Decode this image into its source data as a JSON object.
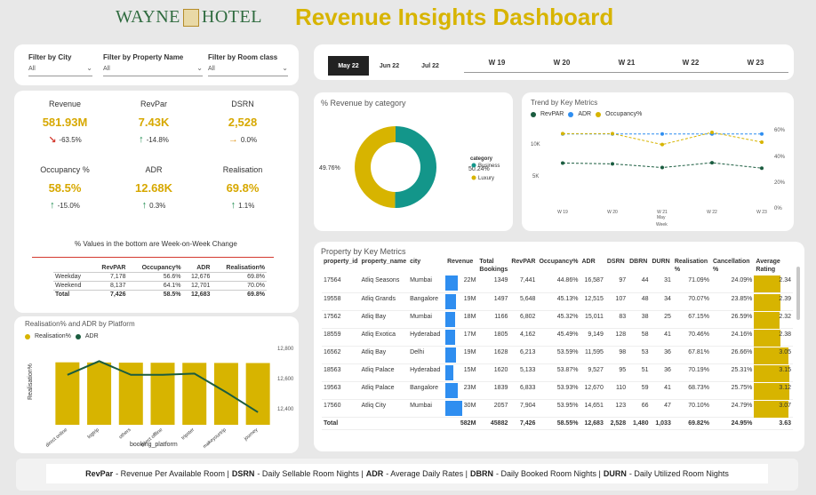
{
  "header": {
    "logo_left": "WAYNE",
    "logo_right": "HOTEL",
    "title": "Revenue Insights Dashboard"
  },
  "filters": [
    {
      "label": "Filter by City",
      "value": "All"
    },
    {
      "label": "Filter by Property Name",
      "value": "All"
    },
    {
      "label": "Filter by Room class",
      "value": "All"
    }
  ],
  "months": [
    "May 22",
    "Jun 22",
    "Jul 22"
  ],
  "weeks": [
    "W 19",
    "W 20",
    "W 21",
    "W 22",
    "W 23"
  ],
  "kpis": [
    {
      "name": "Revenue",
      "value": "581.93M",
      "change": "-63.5%",
      "trend": "down"
    },
    {
      "name": "RevPar",
      "value": "7.43K",
      "change": "-14.8%",
      "trend": "up"
    },
    {
      "name": "DSRN",
      "value": "2,528",
      "change": "0.0%",
      "trend": "flat"
    },
    {
      "name": "Occupancy %",
      "value": "58.5%",
      "change": "-15.0%",
      "trend": "up"
    },
    {
      "name": "ADR",
      "value": "12.68K",
      "change": "0.3%",
      "trend": "up"
    },
    {
      "name": "Realisation",
      "value": "69.8%",
      "change": "1.1%",
      "trend": "up"
    }
  ],
  "kpi_note": "% Values in the bottom are Week-on-Week Change",
  "weekday_table": {
    "headers": [
      "",
      "RevPAR",
      "Occupancy%",
      "ADR",
      "Realisation%"
    ],
    "rows": [
      [
        "Weekday",
        "7,178",
        "56.6%",
        "12,676",
        "69.8%"
      ],
      [
        "Weekend",
        "8,137",
        "64.1%",
        "12,701",
        "70.0%"
      ],
      [
        "Total",
        "7,426",
        "58.5%",
        "12,683",
        "69.8%"
      ]
    ]
  },
  "platform_chart": {
    "title": "Realisation% and ADR by Platform",
    "legend": [
      "Realisation%",
      "ADR"
    ],
    "xlabel": "booking_platform",
    "ylabel": "Realisation%",
    "y2_ticks": [
      "12,800",
      "12,600",
      "12,400"
    ],
    "colors": {
      "bar": "#d7b400",
      "line": "#1a5c3f"
    }
  },
  "category_chart": {
    "title": "% Revenue by category",
    "legend_title": "category",
    "colors": {
      "Business": "#13968a",
      "Luxury": "#d7b400"
    }
  },
  "trend_chart": {
    "title": "Trend by Key Metrics",
    "legend": [
      "RevPAR",
      "ADR",
      "Occupancy%"
    ],
    "y_left_ticks": [
      "10K",
      "5K"
    ],
    "y_right_ticks": [
      "60%",
      "40%",
      "20%",
      "0%"
    ],
    "xlabel": "Week",
    "x_sub": "May",
    "colors": {
      "RevPAR": "#1a5c3f",
      "ADR": "#2f8ef0",
      "Occupancy%": "#d7b400"
    }
  },
  "property_table": {
    "title": "Property by Key Metrics",
    "headers": [
      "property_id",
      "property_name",
      "city",
      "Revenue",
      "Total Bookings",
      "RevPAR",
      "Occupancy%",
      "ADR",
      "DSRN",
      "DBRN",
      "DURN",
      "Realisation %",
      "Cancellation %",
      "Average Rating"
    ],
    "rows": [
      {
        "id": "17564",
        "name": "Atliq Seasons",
        "city": "Mumbai",
        "revenue": "22M",
        "rev_val": 22,
        "bookings": "1349",
        "revpar": "7,441",
        "occ": "44.86%",
        "adr": "16,587",
        "dsrn": "97",
        "dbrn": "44",
        "durn": "31",
        "real": "71.09%",
        "cancel": "24.09%",
        "rating": "2.34",
        "rating_val": 2.34
      },
      {
        "id": "19558",
        "name": "Atliq Grands",
        "city": "Bangalore",
        "revenue": "19M",
        "rev_val": 19,
        "bookings": "1497",
        "revpar": "5,648",
        "occ": "45.13%",
        "adr": "12,515",
        "dsrn": "107",
        "dbrn": "48",
        "durn": "34",
        "real": "70.07%",
        "cancel": "23.85%",
        "rating": "2.39",
        "rating_val": 2.39
      },
      {
        "id": "17562",
        "name": "Atliq Bay",
        "city": "Mumbai",
        "revenue": "18M",
        "rev_val": 18,
        "bookings": "1166",
        "revpar": "6,802",
        "occ": "45.32%",
        "adr": "15,011",
        "dsrn": "83",
        "dbrn": "38",
        "durn": "25",
        "real": "67.15%",
        "cancel": "26.59%",
        "rating": "2.32",
        "rating_val": 2.32
      },
      {
        "id": "18559",
        "name": "Atliq Exotica",
        "city": "Hyderabad",
        "revenue": "17M",
        "rev_val": 17,
        "bookings": "1805",
        "revpar": "4,162",
        "occ": "45.49%",
        "adr": "9,149",
        "dsrn": "128",
        "dbrn": "58",
        "durn": "41",
        "real": "70.46%",
        "cancel": "24.16%",
        "rating": "2.38",
        "rating_val": 2.38
      },
      {
        "id": "16562",
        "name": "Atliq Bay",
        "city": "Delhi",
        "revenue": "19M",
        "rev_val": 19,
        "bookings": "1628",
        "revpar": "6,213",
        "occ": "53.59%",
        "adr": "11,595",
        "dsrn": "98",
        "dbrn": "53",
        "durn": "36",
        "real": "67.81%",
        "cancel": "26.66%",
        "rating": "3.05",
        "rating_val": 3.05
      },
      {
        "id": "18563",
        "name": "Atliq Palace",
        "city": "Hyderabad",
        "revenue": "15M",
        "rev_val": 15,
        "bookings": "1620",
        "revpar": "5,133",
        "occ": "53.87%",
        "adr": "9,527",
        "dsrn": "95",
        "dbrn": "51",
        "durn": "36",
        "real": "70.19%",
        "cancel": "25.31%",
        "rating": "3.15",
        "rating_val": 3.15
      },
      {
        "id": "19563",
        "name": "Atliq Palace",
        "city": "Bangalore",
        "revenue": "23M",
        "rev_val": 23,
        "bookings": "1839",
        "revpar": "6,833",
        "occ": "53.93%",
        "adr": "12,670",
        "dsrn": "110",
        "dbrn": "59",
        "durn": "41",
        "real": "68.73%",
        "cancel": "25.75%",
        "rating": "3.12",
        "rating_val": 3.12
      },
      {
        "id": "17560",
        "name": "Atliq City",
        "city": "Mumbai",
        "revenue": "30M",
        "rev_val": 30,
        "bookings": "2057",
        "revpar": "7,904",
        "occ": "53.95%",
        "adr": "14,651",
        "dsrn": "123",
        "dbrn": "66",
        "durn": "47",
        "real": "70.10%",
        "cancel": "24.79%",
        "rating": "3.07",
        "rating_val": 3.07
      }
    ],
    "total": {
      "label": "Total",
      "revenue": "582M",
      "bookings": "45882",
      "revpar": "7,426",
      "occ": "58.55%",
      "adr": "12,683",
      "dsrn": "2,528",
      "dbrn": "1,480",
      "durn": "1,033",
      "real": "69.82%",
      "cancel": "24.95%",
      "rating": "3.63"
    }
  },
  "footer": {
    "k1": "RevPar",
    "d1": "- Revenue Per Available Room |",
    "k2": "DSRN",
    "d2": "- Daily Sellable Room Nights |",
    "k3": "ADR",
    "d3": "- Average Daily Rates |",
    "k4": "DBRN",
    "d4": "- Daily Booked Room Nights |",
    "k5": "DURN",
    "d5": "- Daily Utilized Room Nights"
  },
  "chart_data": [
    {
      "type": "bar",
      "title": "Realisation% and ADR by Platform",
      "categories": [
        "direct online",
        "logtrip",
        "others",
        "direct offline",
        "tripster",
        "makeyourtrip",
        "journey"
      ],
      "series": [
        {
          "name": "Realisation%",
          "values": [
            70.3,
            70.1,
            69.9,
            69.8,
            69.7,
            69.6,
            69.5
          ]
        },
        {
          "name": "ADR",
          "values": [
            12680,
            12790,
            12680,
            12680,
            12690,
            12540,
            12380
          ]
        }
      ],
      "xlabel": "booking_platform",
      "ylabel": "Realisation%",
      "ylim": [
        0,
        80
      ],
      "y2lim": [
        12350,
        12850
      ]
    },
    {
      "type": "pie",
      "title": "% Revenue by category",
      "categories": [
        "Business",
        "Luxury"
      ],
      "values": [
        50.24,
        49.76
      ]
    },
    {
      "type": "line",
      "title": "Trend by Key Metrics",
      "x": [
        "W 19",
        "W 20",
        "W 21",
        "W 22",
        "W 23"
      ],
      "series": [
        {
          "name": "RevPAR",
          "values": [
            7900,
            7750,
            7100,
            7950,
            7000
          ],
          "axis": "left"
        },
        {
          "name": "ADR",
          "values": [
            13000,
            13000,
            13000,
            13000,
            13000
          ],
          "axis": "left"
        },
        {
          "name": "Occupancy%",
          "values": [
            61,
            61,
            52,
            62,
            54
          ],
          "axis": "right"
        }
      ],
      "ylim": [
        0,
        15000
      ],
      "y2lim": [
        0,
        70
      ]
    }
  ]
}
